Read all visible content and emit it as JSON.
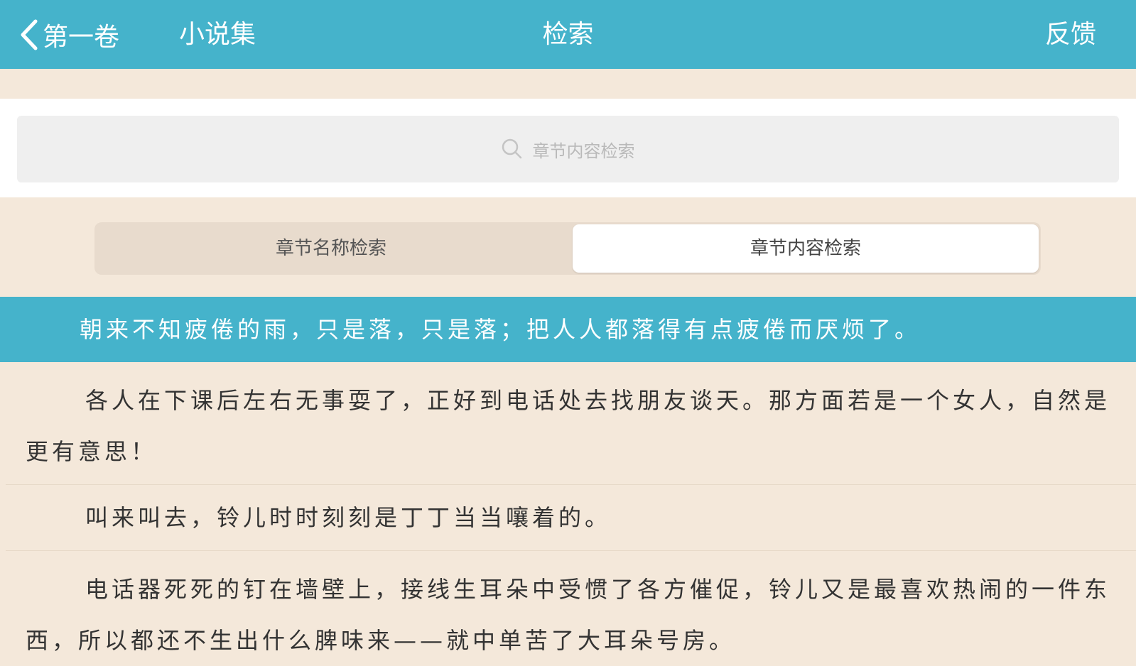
{
  "header": {
    "back_label": "第一卷",
    "collection_label": "小说集",
    "title": "检索",
    "feedback_label": "反馈"
  },
  "search": {
    "placeholder": "章节内容检索"
  },
  "segments": {
    "left_label": "章节名称检索",
    "right_label": "章节内容检索"
  },
  "highlighted_result": "朝来不知疲倦的雨，只是落，只是落；把人人都落得有点疲倦而厌烦了。",
  "results": [
    "各人在下课后左右无事耍了，正好到电话处去找朋友谈天。那方面若是一个女人，自然是更有意思！",
    "叫来叫去，铃儿时时刻刻是丁丁当当嚷着的。",
    "电话器死死的钉在墙壁上，接线生耳朵中受惯了各方催促，铃儿又是最喜欢热闹的一件东西，所以都还不生出什么脾味来——就中单苦了大耳朵号房。"
  ],
  "colors": {
    "accent": "#45b3cb",
    "background": "#f4e8da"
  }
}
